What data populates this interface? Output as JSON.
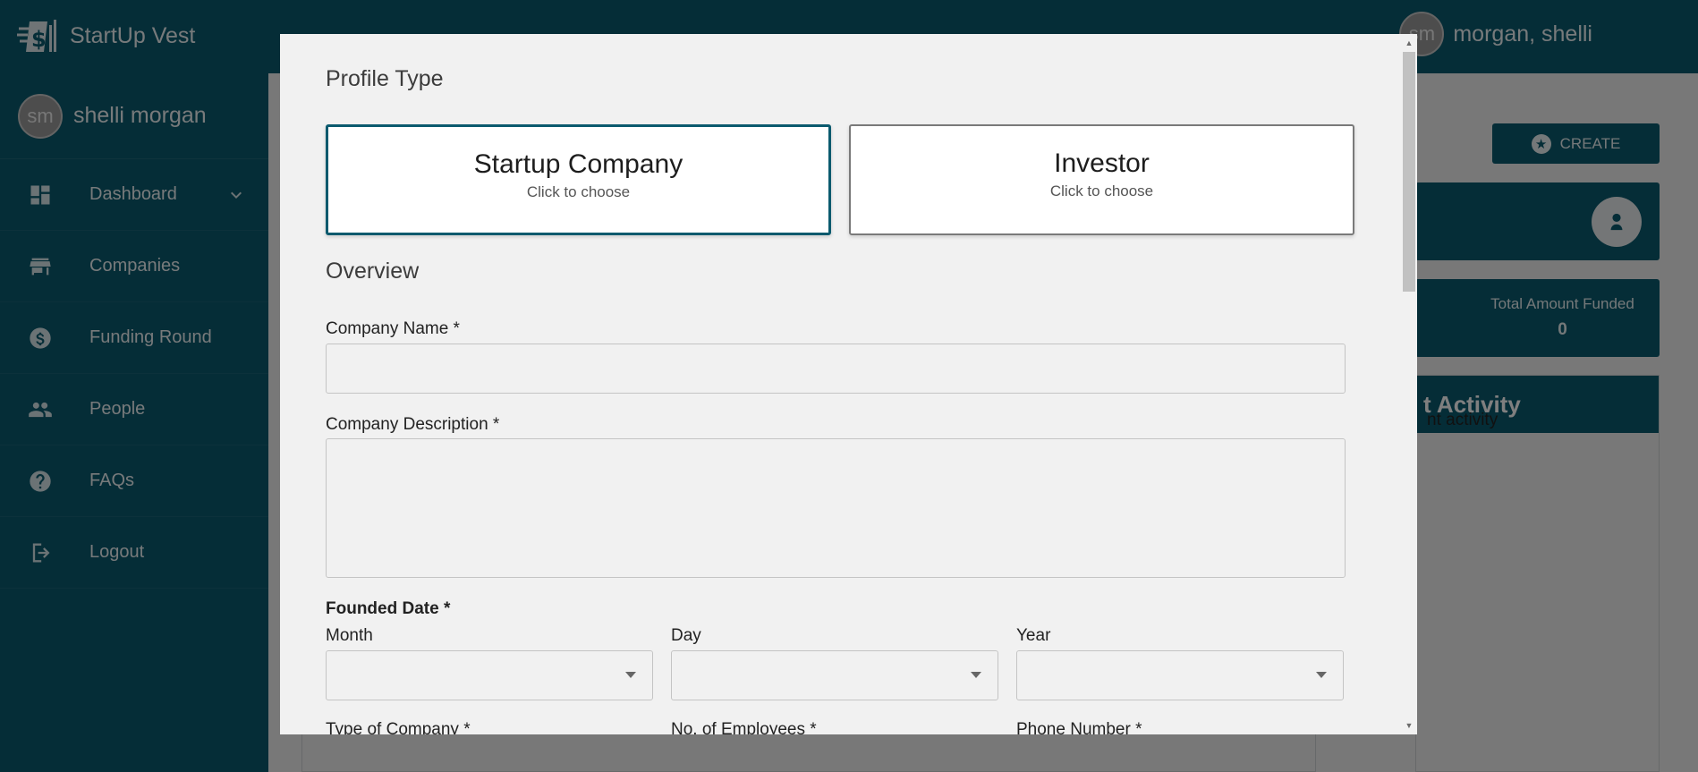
{
  "app": {
    "name": "StartUp Vest",
    "top_user": "morgan, shelli",
    "avatar_initials": "sm"
  },
  "sidebar": {
    "user_name": "shelli morgan",
    "items": [
      {
        "label": "Dashboard",
        "icon": "dashboard-icon"
      },
      {
        "label": "Companies",
        "icon": "store-icon"
      },
      {
        "label": "Funding Round",
        "icon": "dollar-circle-icon"
      },
      {
        "label": "People",
        "icon": "people-icon"
      },
      {
        "label": "FAQs",
        "icon": "help-icon"
      },
      {
        "label": "Logout",
        "icon": "logout-icon"
      }
    ]
  },
  "dashboard": {
    "create_label": "CREATE",
    "funded_label": "Total Amount Funded",
    "funded_value": "0",
    "activity_title": "t Activity",
    "activity_text": "nt activity"
  },
  "modal": {
    "profile_type_title": "Profile Type",
    "choices": [
      {
        "title": "Startup Company",
        "subtitle": "Click to choose",
        "selected": true
      },
      {
        "title": "Investor",
        "subtitle": "Click to choose",
        "selected": false
      }
    ],
    "overview_title": "Overview",
    "company_name_label": "Company Name *",
    "company_name_value": "",
    "company_description_label": "Company Description *",
    "company_description_value": "",
    "founded_date_label": "Founded Date *",
    "month_label": "Month",
    "day_label": "Day",
    "year_label": "Year",
    "type_of_company_label": "Type of Company *",
    "employees_label": "No. of Employees *",
    "phone_label": "Phone Number *"
  },
  "colors": {
    "primary": "#0b5a6e",
    "modal_bg": "#f1f1f1",
    "selected_border": "#0b5a6e"
  }
}
